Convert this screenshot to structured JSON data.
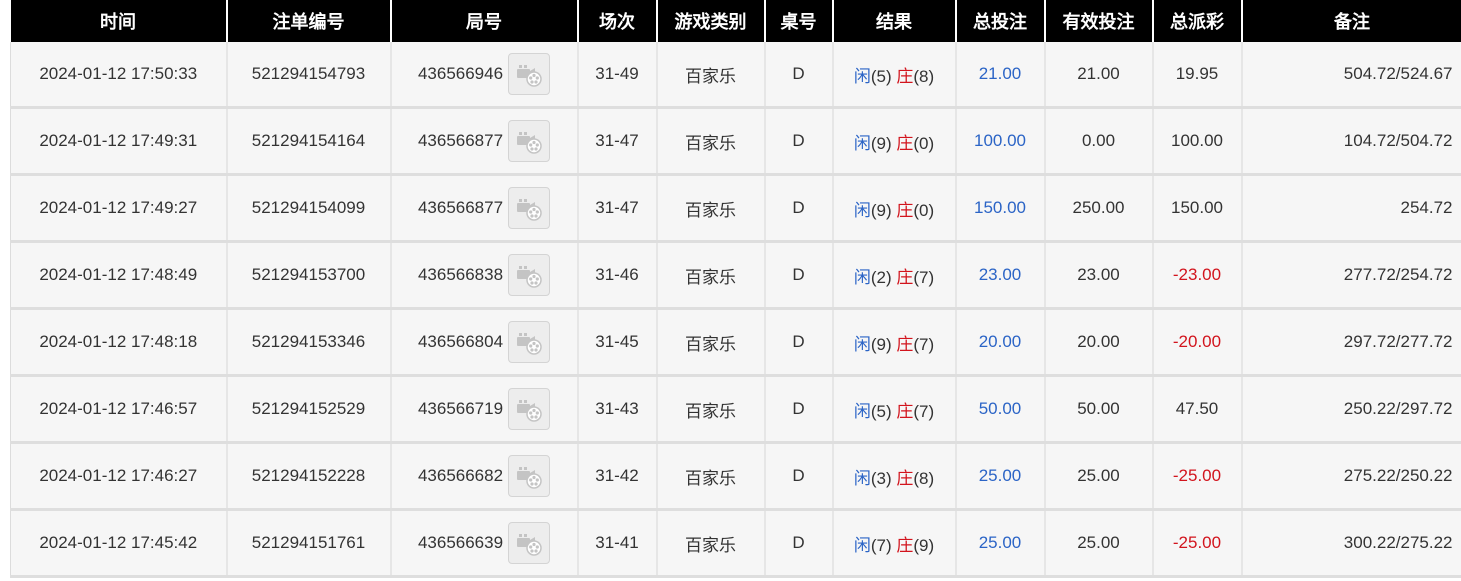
{
  "header": {
    "time": "时间",
    "bet_no": "注单编号",
    "round_no": "局号",
    "shoe": "场次",
    "game_type": "游戏类别",
    "table": "桌号",
    "result": "结果",
    "total_bet": "总投注",
    "valid_bet": "有效投注",
    "payout": "总派彩",
    "note": "备注"
  },
  "icons": {
    "video": "video-replay-icon"
  },
  "colors": {
    "player": "#2b64c6",
    "banker": "#d2141d",
    "negative": "#d2141d",
    "header_bg": "#000000"
  },
  "rows": [
    {
      "time": "2024-01-12 17:50:33",
      "bet_no": "521294154793",
      "round_no": "436566946",
      "shoe": "31-49",
      "game_type": "百家乐",
      "table": "D",
      "player_label": "闲",
      "player_score": "(5)",
      "banker_label": "庄",
      "banker_score": "(8)",
      "total_bet": "21.00",
      "valid_bet": "21.00",
      "payout": "19.95",
      "payout_negative": false,
      "note": "504.72/524.67"
    },
    {
      "time": "2024-01-12 17:49:31",
      "bet_no": "521294154164",
      "round_no": "436566877",
      "shoe": "31-47",
      "game_type": "百家乐",
      "table": "D",
      "player_label": "闲",
      "player_score": "(9)",
      "banker_label": "庄",
      "banker_score": "(0)",
      "total_bet": "100.00",
      "valid_bet": "0.00",
      "payout": "100.00",
      "payout_negative": false,
      "note": "104.72/504.72"
    },
    {
      "time": "2024-01-12 17:49:27",
      "bet_no": "521294154099",
      "round_no": "436566877",
      "shoe": "31-47",
      "game_type": "百家乐",
      "table": "D",
      "player_label": "闲",
      "player_score": "(9)",
      "banker_label": "庄",
      "banker_score": "(0)",
      "total_bet": "150.00",
      "valid_bet": "250.00",
      "payout": "150.00",
      "payout_negative": false,
      "note": "254.72"
    },
    {
      "time": "2024-01-12 17:48:49",
      "bet_no": "521294153700",
      "round_no": "436566838",
      "shoe": "31-46",
      "game_type": "百家乐",
      "table": "D",
      "player_label": "闲",
      "player_score": "(2)",
      "banker_label": "庄",
      "banker_score": "(7)",
      "total_bet": "23.00",
      "valid_bet": "23.00",
      "payout": "-23.00",
      "payout_negative": true,
      "note": "277.72/254.72"
    },
    {
      "time": "2024-01-12 17:48:18",
      "bet_no": "521294153346",
      "round_no": "436566804",
      "shoe": "31-45",
      "game_type": "百家乐",
      "table": "D",
      "player_label": "闲",
      "player_score": "(9)",
      "banker_label": "庄",
      "banker_score": "(7)",
      "total_bet": "20.00",
      "valid_bet": "20.00",
      "payout": "-20.00",
      "payout_negative": true,
      "note": "297.72/277.72"
    },
    {
      "time": "2024-01-12 17:46:57",
      "bet_no": "521294152529",
      "round_no": "436566719",
      "shoe": "31-43",
      "game_type": "百家乐",
      "table": "D",
      "player_label": "闲",
      "player_score": "(5)",
      "banker_label": "庄",
      "banker_score": "(7)",
      "total_bet": "50.00",
      "valid_bet": "50.00",
      "payout": "47.50",
      "payout_negative": false,
      "note": "250.22/297.72"
    },
    {
      "time": "2024-01-12 17:46:27",
      "bet_no": "521294152228",
      "round_no": "436566682",
      "shoe": "31-42",
      "game_type": "百家乐",
      "table": "D",
      "player_label": "闲",
      "player_score": "(3)",
      "banker_label": "庄",
      "banker_score": "(8)",
      "total_bet": "25.00",
      "valid_bet": "25.00",
      "payout": "-25.00",
      "payout_negative": true,
      "note": "275.22/250.22"
    },
    {
      "time": "2024-01-12 17:45:42",
      "bet_no": "521294151761",
      "round_no": "436566639",
      "shoe": "31-41",
      "game_type": "百家乐",
      "table": "D",
      "player_label": "闲",
      "player_score": "(7)",
      "banker_label": "庄",
      "banker_score": "(9)",
      "total_bet": "25.00",
      "valid_bet": "25.00",
      "payout": "-25.00",
      "payout_negative": true,
      "note": "300.22/275.22"
    }
  ]
}
